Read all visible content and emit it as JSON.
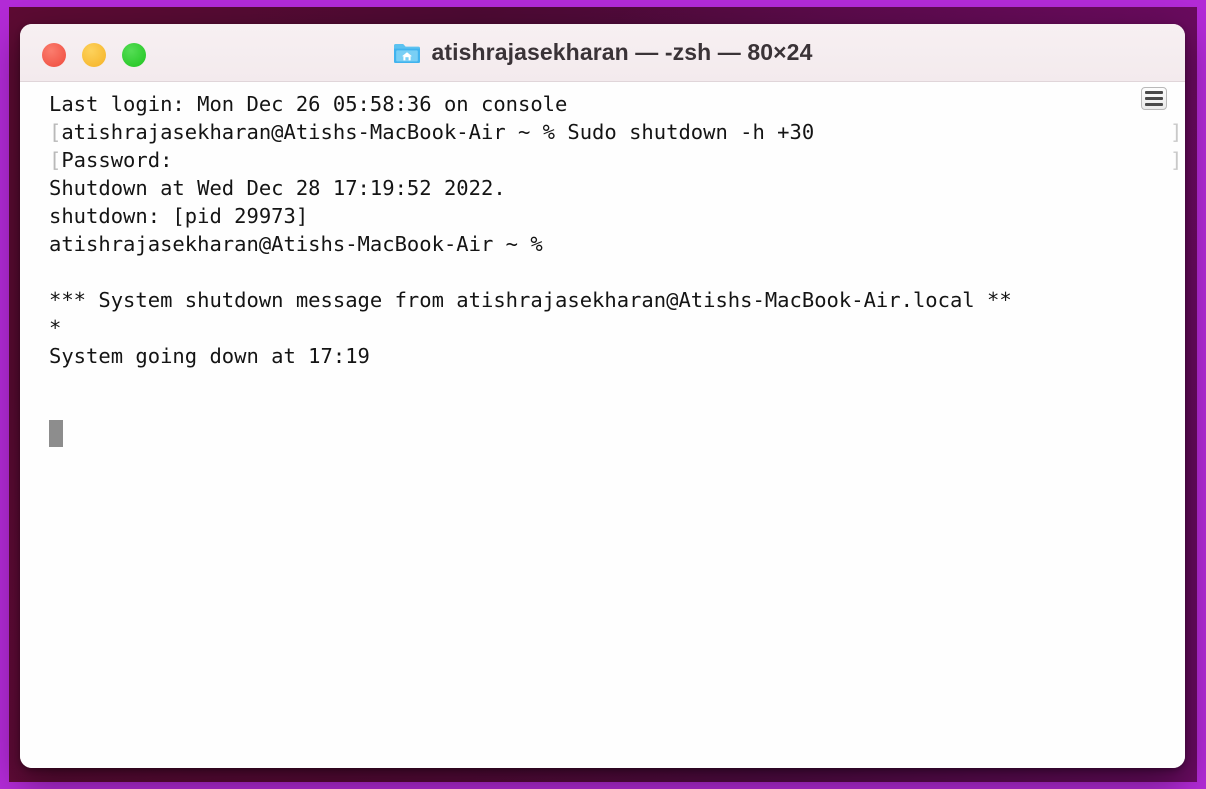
{
  "window": {
    "title": "atishrajasekharan — -zsh — 80×24",
    "folder_icon": "home-folder-icon",
    "traffic_lights": [
      {
        "name": "close",
        "label": "Close",
        "color": "#ef4a3c"
      },
      {
        "name": "minimize",
        "label": "Minimize",
        "color": "#f5b225"
      },
      {
        "name": "maximize",
        "label": "Maximize",
        "color": "#1ec41e"
      }
    ],
    "split_pane_button_label": "Split pane"
  },
  "terminal": {
    "prompt_bracket_open": "[",
    "prompt_bracket_close": "]",
    "cursor": "block-cursor",
    "lines": [
      {
        "text": "Last login: Mon Dec 26 05:58:36 on console",
        "lead_bracket": false,
        "edge_bracket": false
      },
      {
        "text": "atishrajasekharan@Atishs-MacBook-Air ~ % Sudo shutdown -h +30",
        "lead_bracket": true,
        "edge_bracket": true
      },
      {
        "text": "Password:",
        "lead_bracket": true,
        "edge_bracket": true
      },
      {
        "text": "Shutdown at Wed Dec 28 17:19:52 2022.",
        "lead_bracket": false,
        "edge_bracket": false
      },
      {
        "text": "shutdown: [pid 29973]",
        "lead_bracket": false,
        "edge_bracket": false
      },
      {
        "text": "atishrajasekharan@Atishs-MacBook-Air ~ %",
        "lead_bracket": false,
        "edge_bracket": false
      },
      {
        "text": "",
        "lead_bracket": false,
        "edge_bracket": false
      },
      {
        "text": "*** System shutdown message from atishrajasekharan@Atishs-MacBook-Air.local **",
        "lead_bracket": false,
        "edge_bracket": false
      },
      {
        "text": "*",
        "lead_bracket": false,
        "edge_bracket": false
      },
      {
        "text": "System going down at 17:19",
        "lead_bracket": false,
        "edge_bracket": false
      }
    ]
  },
  "colors": {
    "wallpaper_outer": "#b22ad6",
    "wallpaper_inner": "#5d0b33",
    "titlebar": "#f3eaed",
    "terminal_background": "#fefefe",
    "terminal_text": "#141414",
    "cursor": "#8d8d8d"
  }
}
